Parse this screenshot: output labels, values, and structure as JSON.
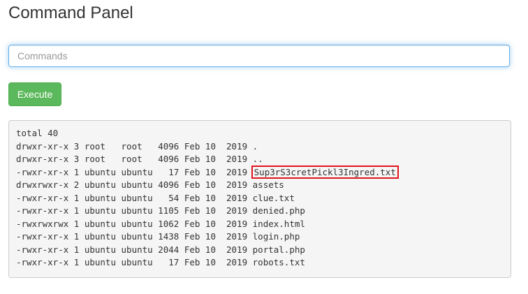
{
  "page": {
    "title": "Command Panel"
  },
  "command_input": {
    "placeholder": "Commands",
    "value": ""
  },
  "execute_button": {
    "label": "Execute",
    "color": "#5cb85c"
  },
  "output": {
    "total_line": "total 40",
    "entries": [
      {
        "meta": "drwxr-xr-x 3 root   root   4096 Feb 10  2019 ",
        "name": "."
      },
      {
        "meta": "drwxr-xr-x 3 root   root   4096 Feb 10  2019 ",
        "name": ".."
      },
      {
        "meta": "-rwxr-xr-x 1 ubuntu ubuntu   17 Feb 10  2019 ",
        "name": "Sup3rS3cretPickl3Ingred.txt"
      },
      {
        "meta": "drwxrwxr-x 2 ubuntu ubuntu 4096 Feb 10  2019 ",
        "name": "assets"
      },
      {
        "meta": "-rwxr-xr-x 1 ubuntu ubuntu   54 Feb 10  2019 ",
        "name": "clue.txt"
      },
      {
        "meta": "-rwxr-xr-x 1 ubuntu ubuntu 1105 Feb 10  2019 ",
        "name": "denied.php"
      },
      {
        "meta": "-rwxrwxrwx 1 ubuntu ubuntu 1062 Feb 10  2019 ",
        "name": "index.html"
      },
      {
        "meta": "-rwxr-xr-x 1 ubuntu ubuntu 1438 Feb 10  2019 ",
        "name": "login.php"
      },
      {
        "meta": "-rwxr-xr-x 1 ubuntu ubuntu 2044 Feb 10  2019 ",
        "name": "portal.php"
      },
      {
        "meta": "-rwxr-xr-x 1 ubuntu ubuntu   17 Feb 10  2019 ",
        "name": "robots.txt"
      }
    ],
    "highlight_color": "#e0141e"
  }
}
